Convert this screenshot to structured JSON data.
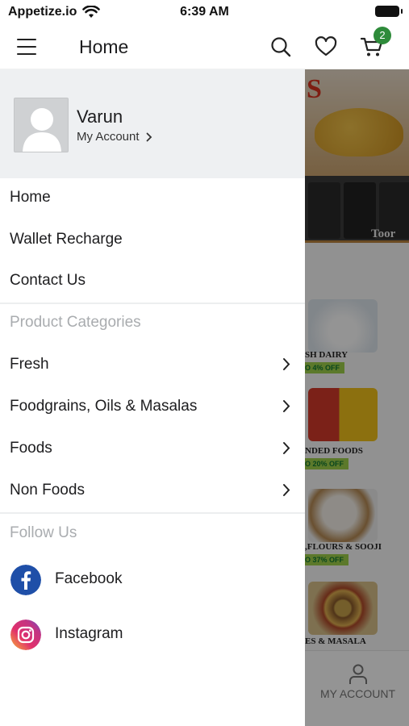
{
  "status_bar": {
    "carrier": "Appetize.io",
    "time": "6:39 AM"
  },
  "header": {
    "title": "Home",
    "cart_count": "2"
  },
  "drawer": {
    "user_name": "Varun",
    "account_link": "My Account",
    "main_items": [
      "Home",
      "Wallet Recharge",
      "Contact Us"
    ],
    "categories_heading": "Product Categories",
    "categories": [
      "Fresh",
      "Foodgrains, Oils & Masalas",
      "Foods",
      "Non Foods"
    ],
    "follow_heading": "Follow Us",
    "social": [
      "Facebook",
      "Instagram"
    ]
  },
  "background": {
    "banner_letter": "S",
    "pack_label": "Toor",
    "sections": [
      {
        "title": "SH DAIRY",
        "offer": "O 4% OFF"
      },
      {
        "title": "NDED FOODS",
        "offer": "O 20% OFF"
      },
      {
        "title": ",FLOURS & SOOJI",
        "offer": "O 37% OFF"
      },
      {
        "title": "ES & MASALA",
        "offer": ""
      }
    ],
    "tab_label": "MY ACCOUNT"
  },
  "colors": {
    "accent_green": "#2e8b3a",
    "offer_green": "#9fd14a",
    "drawer_header_bg": "#eef0f2",
    "facebook_blue": "#1f4fa8"
  },
  "icons": [
    "wifi-icon",
    "battery-icon",
    "hamburger-icon",
    "search-icon",
    "heart-icon",
    "cart-icon",
    "chevron-right-icon",
    "facebook-icon",
    "instagram-icon",
    "person-icon"
  ]
}
